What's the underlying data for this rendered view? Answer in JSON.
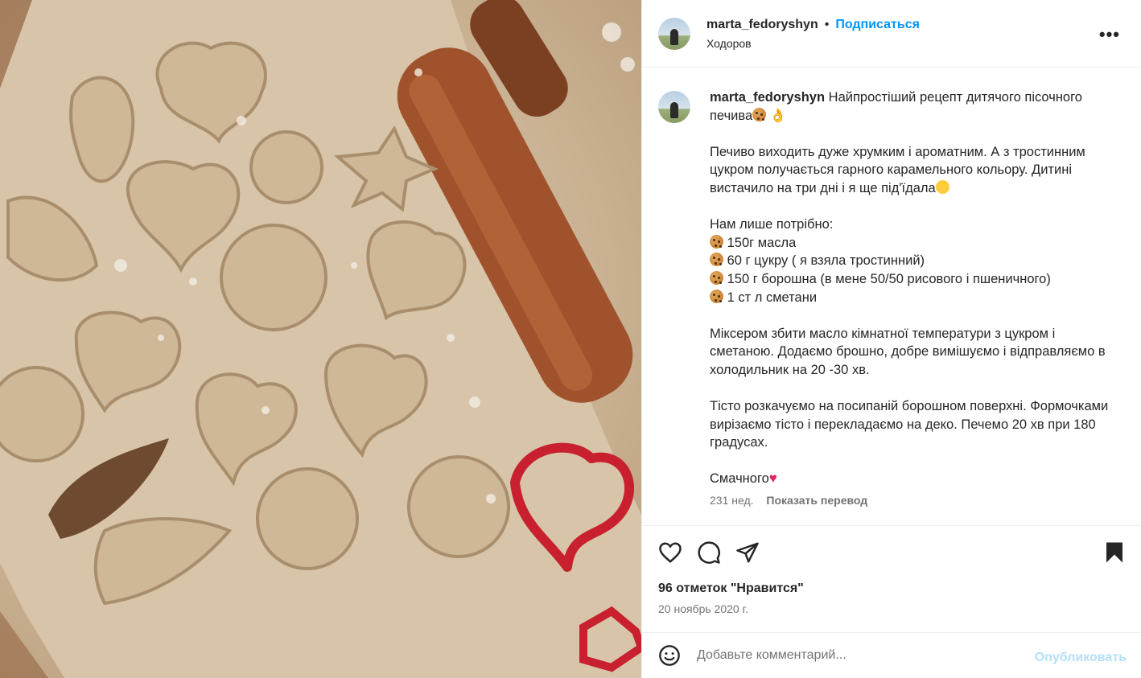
{
  "post": {
    "username": "marta_fedoryshyn",
    "follow_label": "Подписаться",
    "location": "Ходоров",
    "more_label": "•••"
  },
  "caption": {
    "username": "marta_fedoryshyn",
    "line1": "Найпростіший рецепт дитячого пісочного печива",
    "para2": "Печиво виходить дуже хрумким і ароматним. А з тростинним цукром получається гарного карамельного кольору. Дитині вистачило на три дні і я ще під'їдала",
    "need_title": "Нам лише потрібно:",
    "ingredients": [
      "150г масла",
      "60 г цукру ( я взяла тростинний)",
      "150 г борошна (в мене 50/50 рисового і пшеничного)",
      "1 ст л сметани"
    ],
    "para4": "Міксером збити масло кімнатної температури з цукром і сметаною. Додаємо брошно, добре вимішуємо і відправляємо в холодильник на 20 -30 хв.",
    "para5": "Тісто розкачуємо на посипаній борошном поверхні. Формочками вирізаємо тісто і перекладаємо на деко. Печемо 20 хв при 180 градусах.",
    "closing": "Смачного",
    "age": "231 нед.",
    "translate_label": "Показать перевод"
  },
  "icons": {
    "cookie": "cookie-emoji",
    "ok": "ok-hand-emoji",
    "yum": "yum-emoji",
    "heart": "red-heart-emoji",
    "like": "heart-icon",
    "comment": "comment-icon",
    "share": "share-icon",
    "save": "bookmark-icon",
    "emoji_picker": "smiley-icon"
  },
  "stats": {
    "likes": "96 отметок \"Нравится\"",
    "date": "20 ноябрь 2020 г."
  },
  "comment": {
    "placeholder": "Добавьте комментарий...",
    "publish_label": "Опубликовать"
  },
  "colors": {
    "accent": "#0095f6",
    "publish_disabled": "#b2dffc",
    "text_secondary": "#737373"
  }
}
